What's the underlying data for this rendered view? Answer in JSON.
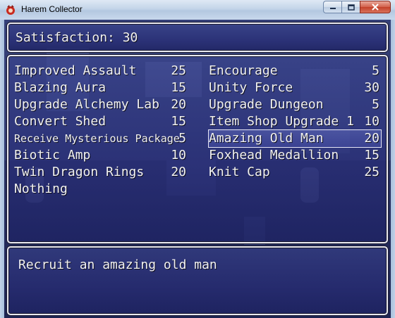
{
  "window": {
    "title": "Harem Collector"
  },
  "status": {
    "satisfaction_text": "Satisfaction: 30"
  },
  "shop": {
    "left_column": [
      {
        "name": "Improved Assault",
        "cost": "25"
      },
      {
        "name": "Blazing Aura",
        "cost": "15"
      },
      {
        "name": "Upgrade Alchemy Lab",
        "cost": "20"
      },
      {
        "name": "Convert Shed",
        "cost": "15"
      },
      {
        "name": "Receive Mysterious Package",
        "cost": "5"
      },
      {
        "name": "Biotic Amp",
        "cost": "10"
      },
      {
        "name": "Twin Dragon Rings",
        "cost": "20"
      },
      {
        "name": "Nothing",
        "cost": ""
      }
    ],
    "right_column": [
      {
        "name": "Encourage",
        "cost": "5"
      },
      {
        "name": "Unity Force",
        "cost": "30"
      },
      {
        "name": "Upgrade Dungeon",
        "cost": "5"
      },
      {
        "name": "Item Shop Upgrade 1",
        "cost": "10"
      },
      {
        "name": "Amazing Old Man",
        "cost": "20"
      },
      {
        "name": "Foxhead Medallion",
        "cost": "15"
      },
      {
        "name": "Knit Cap",
        "cost": "25"
      }
    ],
    "selected": "Amazing Old Man"
  },
  "description": {
    "text": "Recruit an amazing old man"
  },
  "colors": {
    "panel_fill": "#2d3585",
    "panel_border": "#e8e8f0",
    "text": "#f2f2f2",
    "close_button": "#c2412a"
  },
  "icons": {
    "app": "red-game-icon",
    "minimize": "minimize-icon",
    "maximize": "maximize-icon",
    "close": "close-icon"
  }
}
